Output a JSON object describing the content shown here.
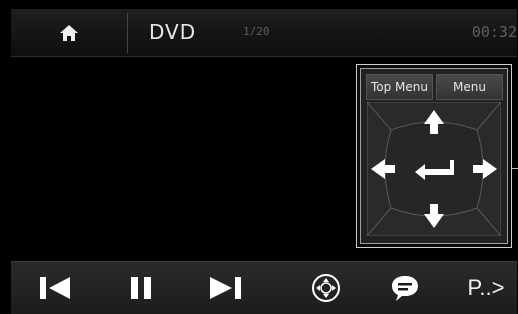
{
  "topbar": {
    "home_icon": "home-icon",
    "title": "DVD",
    "track_info": "1/20",
    "clock": "00:32"
  },
  "nav_panel": {
    "top_menu_label": "Top Menu",
    "menu_label": "Menu",
    "icons": [
      "arrow-up-icon",
      "arrow-left-icon",
      "enter-icon",
      "arrow-right-icon",
      "arrow-down-icon"
    ]
  },
  "bottombar": {
    "icons": [
      "previous-icon",
      "pause-icon",
      "next-icon",
      "dpad-icon",
      "subtitle-icon"
    ],
    "page_label": "P..>"
  },
  "colors": {
    "background": "#000000",
    "bar": "#1c1c1c",
    "icon": "#ffffff"
  }
}
